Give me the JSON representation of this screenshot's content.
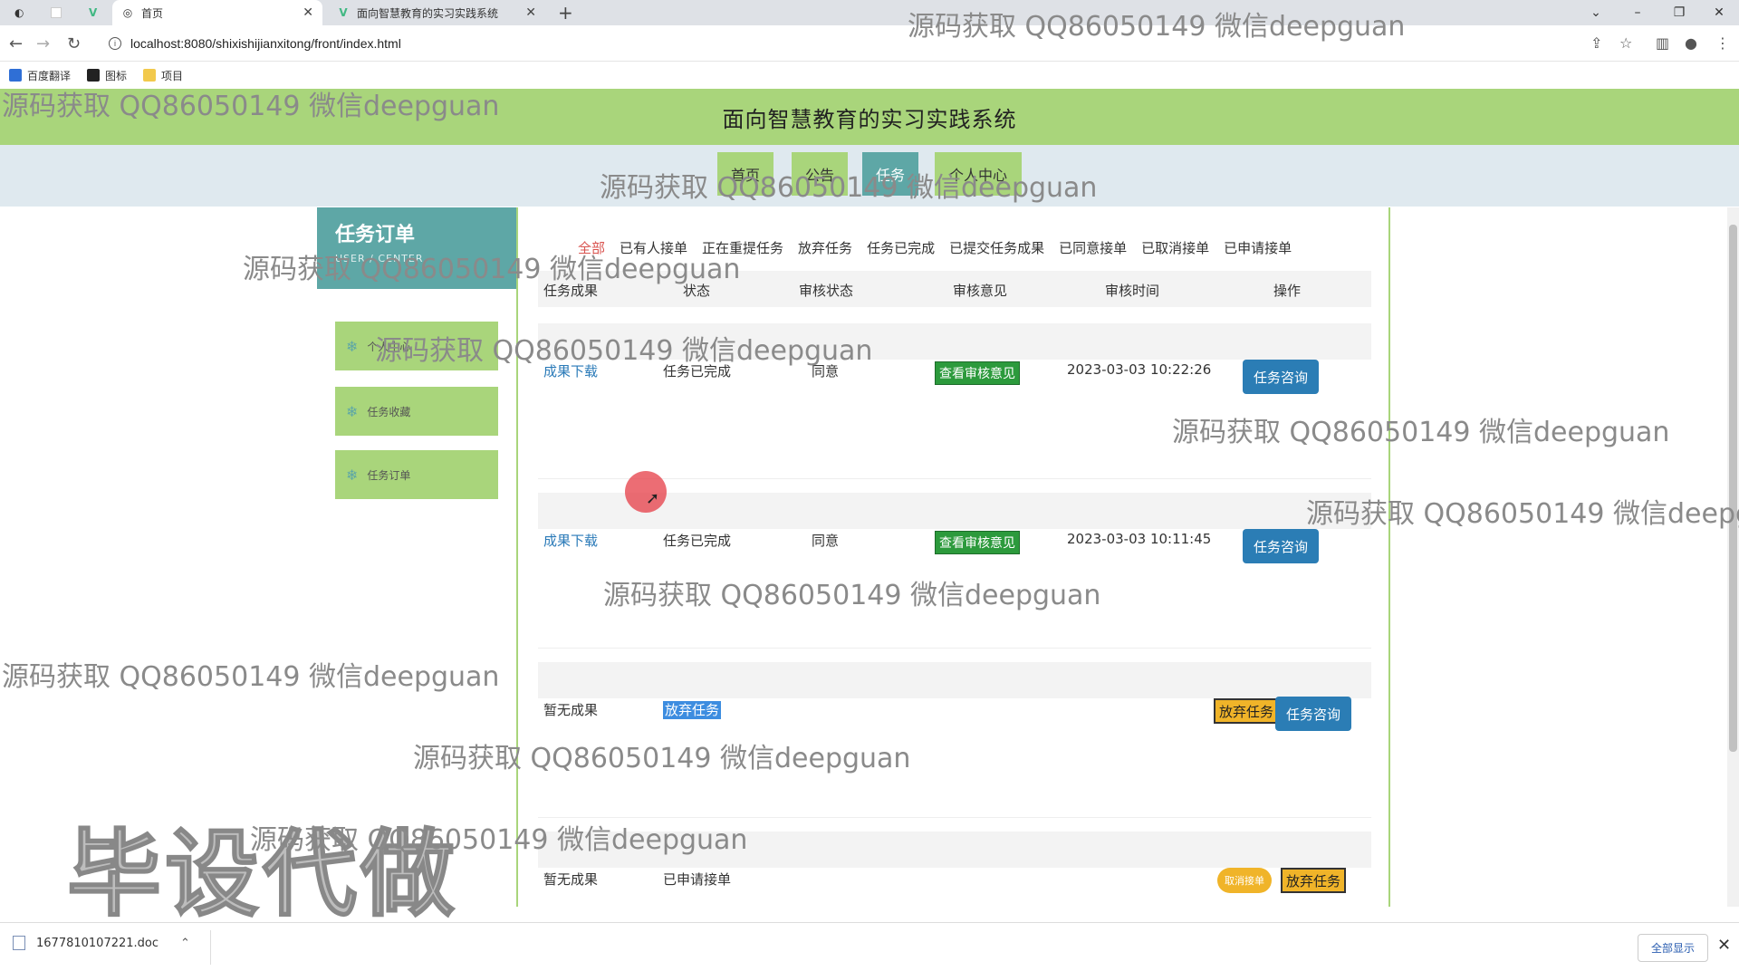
{
  "browser": {
    "tabs": [
      {
        "label": "",
        "icon": "globe-icon"
      },
      {
        "label": "",
        "icon": "blank-page-icon"
      },
      {
        "label": "",
        "icon": "vue-icon"
      },
      {
        "label": "首页",
        "icon": "globe-icon"
      },
      {
        "label": "面向智慧教育的实习实践系统",
        "icon": "vue-icon"
      }
    ],
    "url": "localhost:8080/shixishijianxitong/front/index.html",
    "bookmarks": [
      {
        "label": "百度翻译",
        "icon": "translate-icon",
        "color": "#2f6fd6"
      },
      {
        "label": "图标",
        "icon": "folder-dark-icon",
        "color": "#222222"
      },
      {
        "label": "项目",
        "icon": "folder-icon",
        "color": "#f2c94c"
      }
    ]
  },
  "site": {
    "title": "面向智慧教育的实习实践系统",
    "nav": [
      "首页",
      "公告",
      "任务",
      "个人中心"
    ],
    "active_nav": "任务",
    "accent_green": "#a9d57b",
    "accent_teal": "#5ea7a6"
  },
  "sidebar": {
    "title": "任务订单",
    "subtitle": "USER / CENTER",
    "items": [
      "个人中心",
      "任务收藏",
      "任务订单"
    ]
  },
  "filters": [
    "全部",
    "已有人接单",
    "正在重提任务",
    "放弃任务",
    "任务已完成",
    "已提交任务成果",
    "已同意接单",
    "已取消接单",
    "已申请接单"
  ],
  "active_filter": "全部",
  "table": {
    "headers": [
      "任务成果",
      "状态",
      "审核状态",
      "审核意见",
      "审核时间",
      "操作"
    ]
  },
  "orders": [
    {
      "result": "成果下载",
      "status": "任务已完成",
      "review": "同意",
      "opinion": "查看审核意见",
      "time": "2023-03-03 10:22:26",
      "action": "任务咨询"
    },
    {
      "result": "成果下载",
      "status": "任务已完成",
      "review": "同意",
      "opinion": "查看审核意见",
      "time": "2023-03-03 10:11:45",
      "action": "任务咨询"
    },
    {
      "result": "暂无成果",
      "status": "放弃任务",
      "action_giveup": "放弃任务",
      "action": "任务咨询"
    },
    {
      "result": "暂无成果",
      "status": "已申请接单",
      "action_cancel": "取消接单",
      "action_giveup": "放弃任务"
    }
  ],
  "watermarks": {
    "text": "源码获取 QQ86050149 微信deepguan",
    "partial": "源码获取 QQ86050149 微信deepg",
    "big": "毕设代做"
  },
  "download": {
    "file": "1677810107221.doc",
    "show_all": "全部显示"
  }
}
